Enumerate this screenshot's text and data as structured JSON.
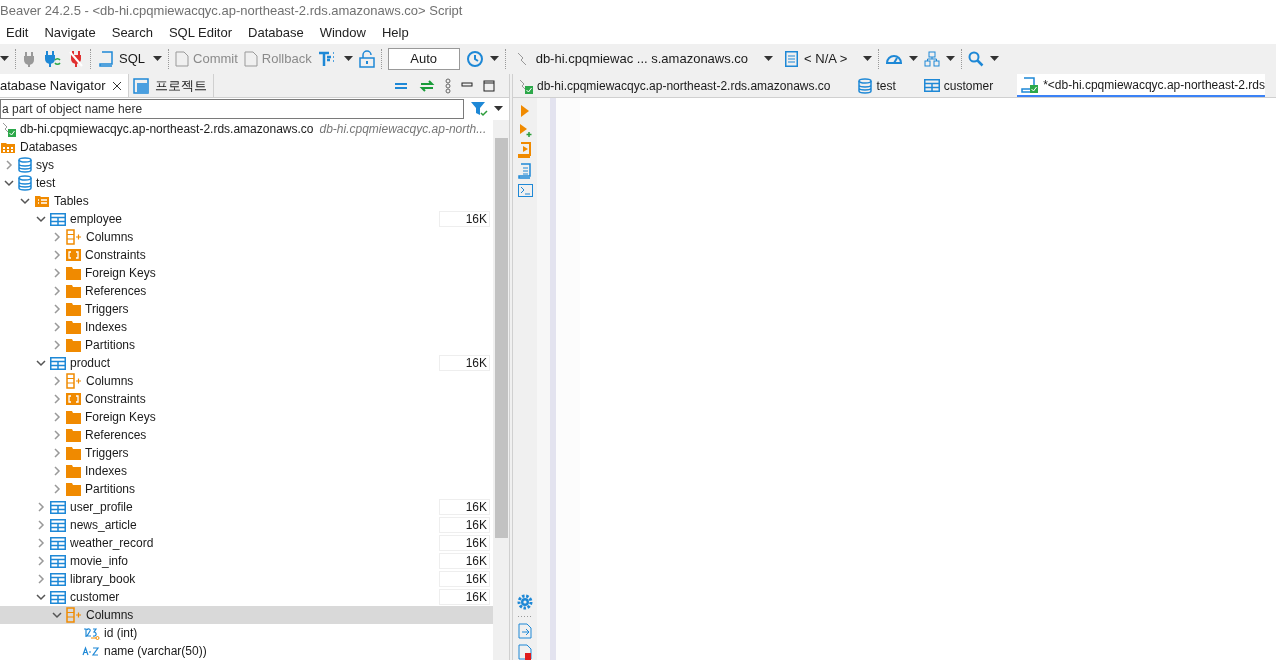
{
  "window": {
    "title": "Beaver 24.2.5 - <db-hi.cpqmiewacqyc.ap-northeast-2.rds.amazonaws.co> Script"
  },
  "menu": [
    "Edit",
    "Navigate",
    "Search",
    "SQL Editor",
    "Database",
    "Window",
    "Help"
  ],
  "toolbar": {
    "sql": "SQL",
    "commit": {
      "label": "Commit",
      "disabled": true
    },
    "rollback": {
      "label": "Rollback",
      "disabled": true
    },
    "transaction_mode": "Auto",
    "connection": "db-hi.cpqmiewac ... s.amazonaws.co",
    "schema": "< N/A >"
  },
  "navigator": {
    "tabs": [
      {
        "label": "atabase Navigator",
        "selected": true
      },
      {
        "label": "프로젝트",
        "selected": false
      }
    ],
    "filter": {
      "placeholder": "a part of object name here"
    },
    "tree": [
      {
        "kind": "connection",
        "label": "db-hi.cpqmiewacqyc.ap-northeast-2.rds.amazonaws.co",
        "note": "db-hi.cpqmiewacqyc.ap-north...",
        "children": [
          {
            "kind": "databases",
            "label": "Databases",
            "children": [
              {
                "kind": "database",
                "label": "sys",
                "expanded": false
              },
              {
                "kind": "database",
                "label": "test",
                "expanded": true,
                "children": [
                  {
                    "kind": "tables",
                    "label": "Tables",
                    "expanded": true,
                    "children": [
                      {
                        "kind": "table",
                        "label": "employee",
                        "size": "16K",
                        "expanded": true,
                        "children": [
                          {
                            "kind": "columns",
                            "label": "Columns",
                            "expanded": false
                          },
                          {
                            "kind": "constraints",
                            "label": "Constraints",
                            "expanded": false
                          },
                          {
                            "kind": "folder",
                            "label": "Foreign Keys",
                            "expanded": false
                          },
                          {
                            "kind": "folder",
                            "label": "References",
                            "expanded": false
                          },
                          {
                            "kind": "folder",
                            "label": "Triggers",
                            "expanded": false
                          },
                          {
                            "kind": "folder",
                            "label": "Indexes",
                            "expanded": false
                          },
                          {
                            "kind": "folder",
                            "label": "Partitions",
                            "expanded": false
                          }
                        ]
                      },
                      {
                        "kind": "table",
                        "label": "product",
                        "size": "16K",
                        "expanded": true,
                        "children": [
                          {
                            "kind": "columns",
                            "label": "Columns",
                            "expanded": false
                          },
                          {
                            "kind": "constraints",
                            "label": "Constraints",
                            "expanded": false
                          },
                          {
                            "kind": "folder",
                            "label": "Foreign Keys",
                            "expanded": false
                          },
                          {
                            "kind": "folder",
                            "label": "References",
                            "expanded": false
                          },
                          {
                            "kind": "folder",
                            "label": "Triggers",
                            "expanded": false
                          },
                          {
                            "kind": "folder",
                            "label": "Indexes",
                            "expanded": false
                          },
                          {
                            "kind": "folder",
                            "label": "Partitions",
                            "expanded": false
                          }
                        ]
                      },
                      {
                        "kind": "table",
                        "label": "user_profile",
                        "size": "16K",
                        "expanded": false
                      },
                      {
                        "kind": "table",
                        "label": "news_article",
                        "size": "16K",
                        "expanded": false
                      },
                      {
                        "kind": "table",
                        "label": "weather_record",
                        "size": "16K",
                        "expanded": false
                      },
                      {
                        "kind": "table",
                        "label": "movie_info",
                        "size": "16K",
                        "expanded": false
                      },
                      {
                        "kind": "table",
                        "label": "library_book",
                        "size": "16K",
                        "expanded": false
                      },
                      {
                        "kind": "table",
                        "label": "customer",
                        "size": "16K",
                        "expanded": true,
                        "children": [
                          {
                            "kind": "columns",
                            "label": "Columns",
                            "expanded": true,
                            "selected": true,
                            "children": [
                              {
                                "kind": "int-column",
                                "label": "id (int)"
                              },
                              {
                                "kind": "text-column",
                                "label": "name (varchar(50))"
                              }
                            ]
                          }
                        ]
                      }
                    ]
                  }
                ]
              }
            ]
          }
        ]
      }
    ]
  },
  "editor": {
    "tabs": [
      {
        "kind": "connection",
        "label": "db-hi.cpqmiewacqyc.ap-northeast-2.rds.amazonaws.co",
        "selected": false
      },
      {
        "kind": "database",
        "label": "test",
        "selected": false
      },
      {
        "kind": "table",
        "label": "customer",
        "selected": false
      },
      {
        "kind": "script",
        "label": "*<db-hi.cpqmiewacqyc.ap-northeast-2.rds",
        "selected": true
      }
    ]
  }
}
